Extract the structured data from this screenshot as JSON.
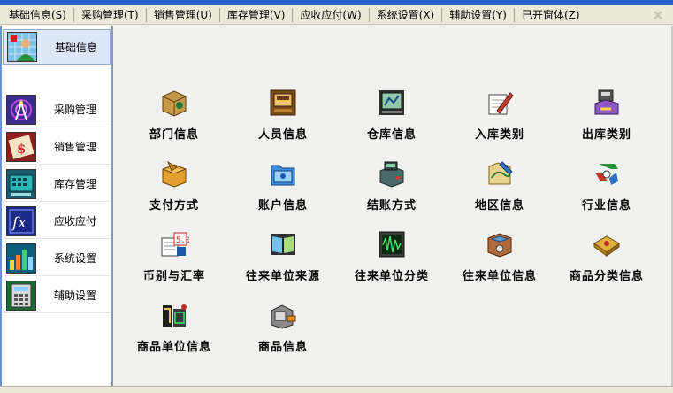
{
  "menubar": {
    "items": [
      {
        "label": "基础信息(S)"
      },
      {
        "label": "采购管理(T)"
      },
      {
        "label": "销售管理(U)"
      },
      {
        "label": "库存管理(V)"
      },
      {
        "label": "应收应付(W)"
      },
      {
        "label": "系统设置(X)"
      },
      {
        "label": "辅助设置(Y)"
      },
      {
        "label": "已开窗体(Z)"
      }
    ]
  },
  "sidebar": {
    "items": [
      {
        "label": "基础信息",
        "icon": "user-grid-icon",
        "active": true
      },
      {
        "label": "采购管理",
        "icon": "broadcast-icon"
      },
      {
        "label": "销售管理",
        "icon": "sales-book-icon"
      },
      {
        "label": "库存管理",
        "icon": "inventory-monitor-icon"
      },
      {
        "label": "应收应付",
        "icon": "fx-function-icon"
      },
      {
        "label": "系统设置",
        "icon": "system-chart-icon"
      },
      {
        "label": "辅助设置",
        "icon": "calculator-icon"
      }
    ]
  },
  "tiles": [
    {
      "label": "部门信息",
      "icon": "department-icon"
    },
    {
      "label": "人员信息",
      "icon": "personnel-icon"
    },
    {
      "label": "仓库信息",
      "icon": "warehouse-icon"
    },
    {
      "label": "入库类别",
      "icon": "stock-in-icon"
    },
    {
      "label": "出库类别",
      "icon": "stock-out-icon"
    },
    {
      "label": "支付方式",
      "icon": "payment-box-icon"
    },
    {
      "label": "账户信息",
      "icon": "account-folder-icon"
    },
    {
      "label": "结账方式",
      "icon": "settlement-machine-icon"
    },
    {
      "label": "地区信息",
      "icon": "region-icon"
    },
    {
      "label": "行业信息",
      "icon": "industry-recycle-icon"
    },
    {
      "label": "币别与汇率",
      "icon": "currency-rate-icon"
    },
    {
      "label": "往来单位来源",
      "icon": "partner-source-book-icon"
    },
    {
      "label": "往来单位分类",
      "icon": "partner-category-monitor-icon"
    },
    {
      "label": "往来单位信息",
      "icon": "partner-info-box-icon"
    },
    {
      "label": "商品分类信息",
      "icon": "product-category-icon"
    },
    {
      "label": "商品单位信息",
      "icon": "product-unit-icon"
    },
    {
      "label": "商品信息",
      "icon": "product-info-icon"
    }
  ]
}
